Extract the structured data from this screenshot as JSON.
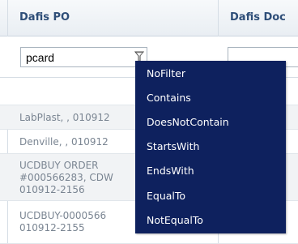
{
  "columns": [
    "Dafis PO",
    "Dafis Doc"
  ],
  "filter": {
    "value": "pcard",
    "icon": "filter-icon"
  },
  "rows": [
    "LabPlast, , 010912",
    "Denville, , 010912",
    "UCDBUY ORDER\n#000566283, CDW\n010912-2156",
    "UCDBUY-0000566\n010912-2155"
  ],
  "menu": [
    "NoFilter",
    "Contains",
    "DoesNotContain",
    "StartsWith",
    "EndsWith",
    "EqualTo",
    "NotEqualTo"
  ],
  "colors": {
    "header_text": "#2e4e78",
    "menu_bg": "#0e215e",
    "row_text": "#7a8592"
  }
}
